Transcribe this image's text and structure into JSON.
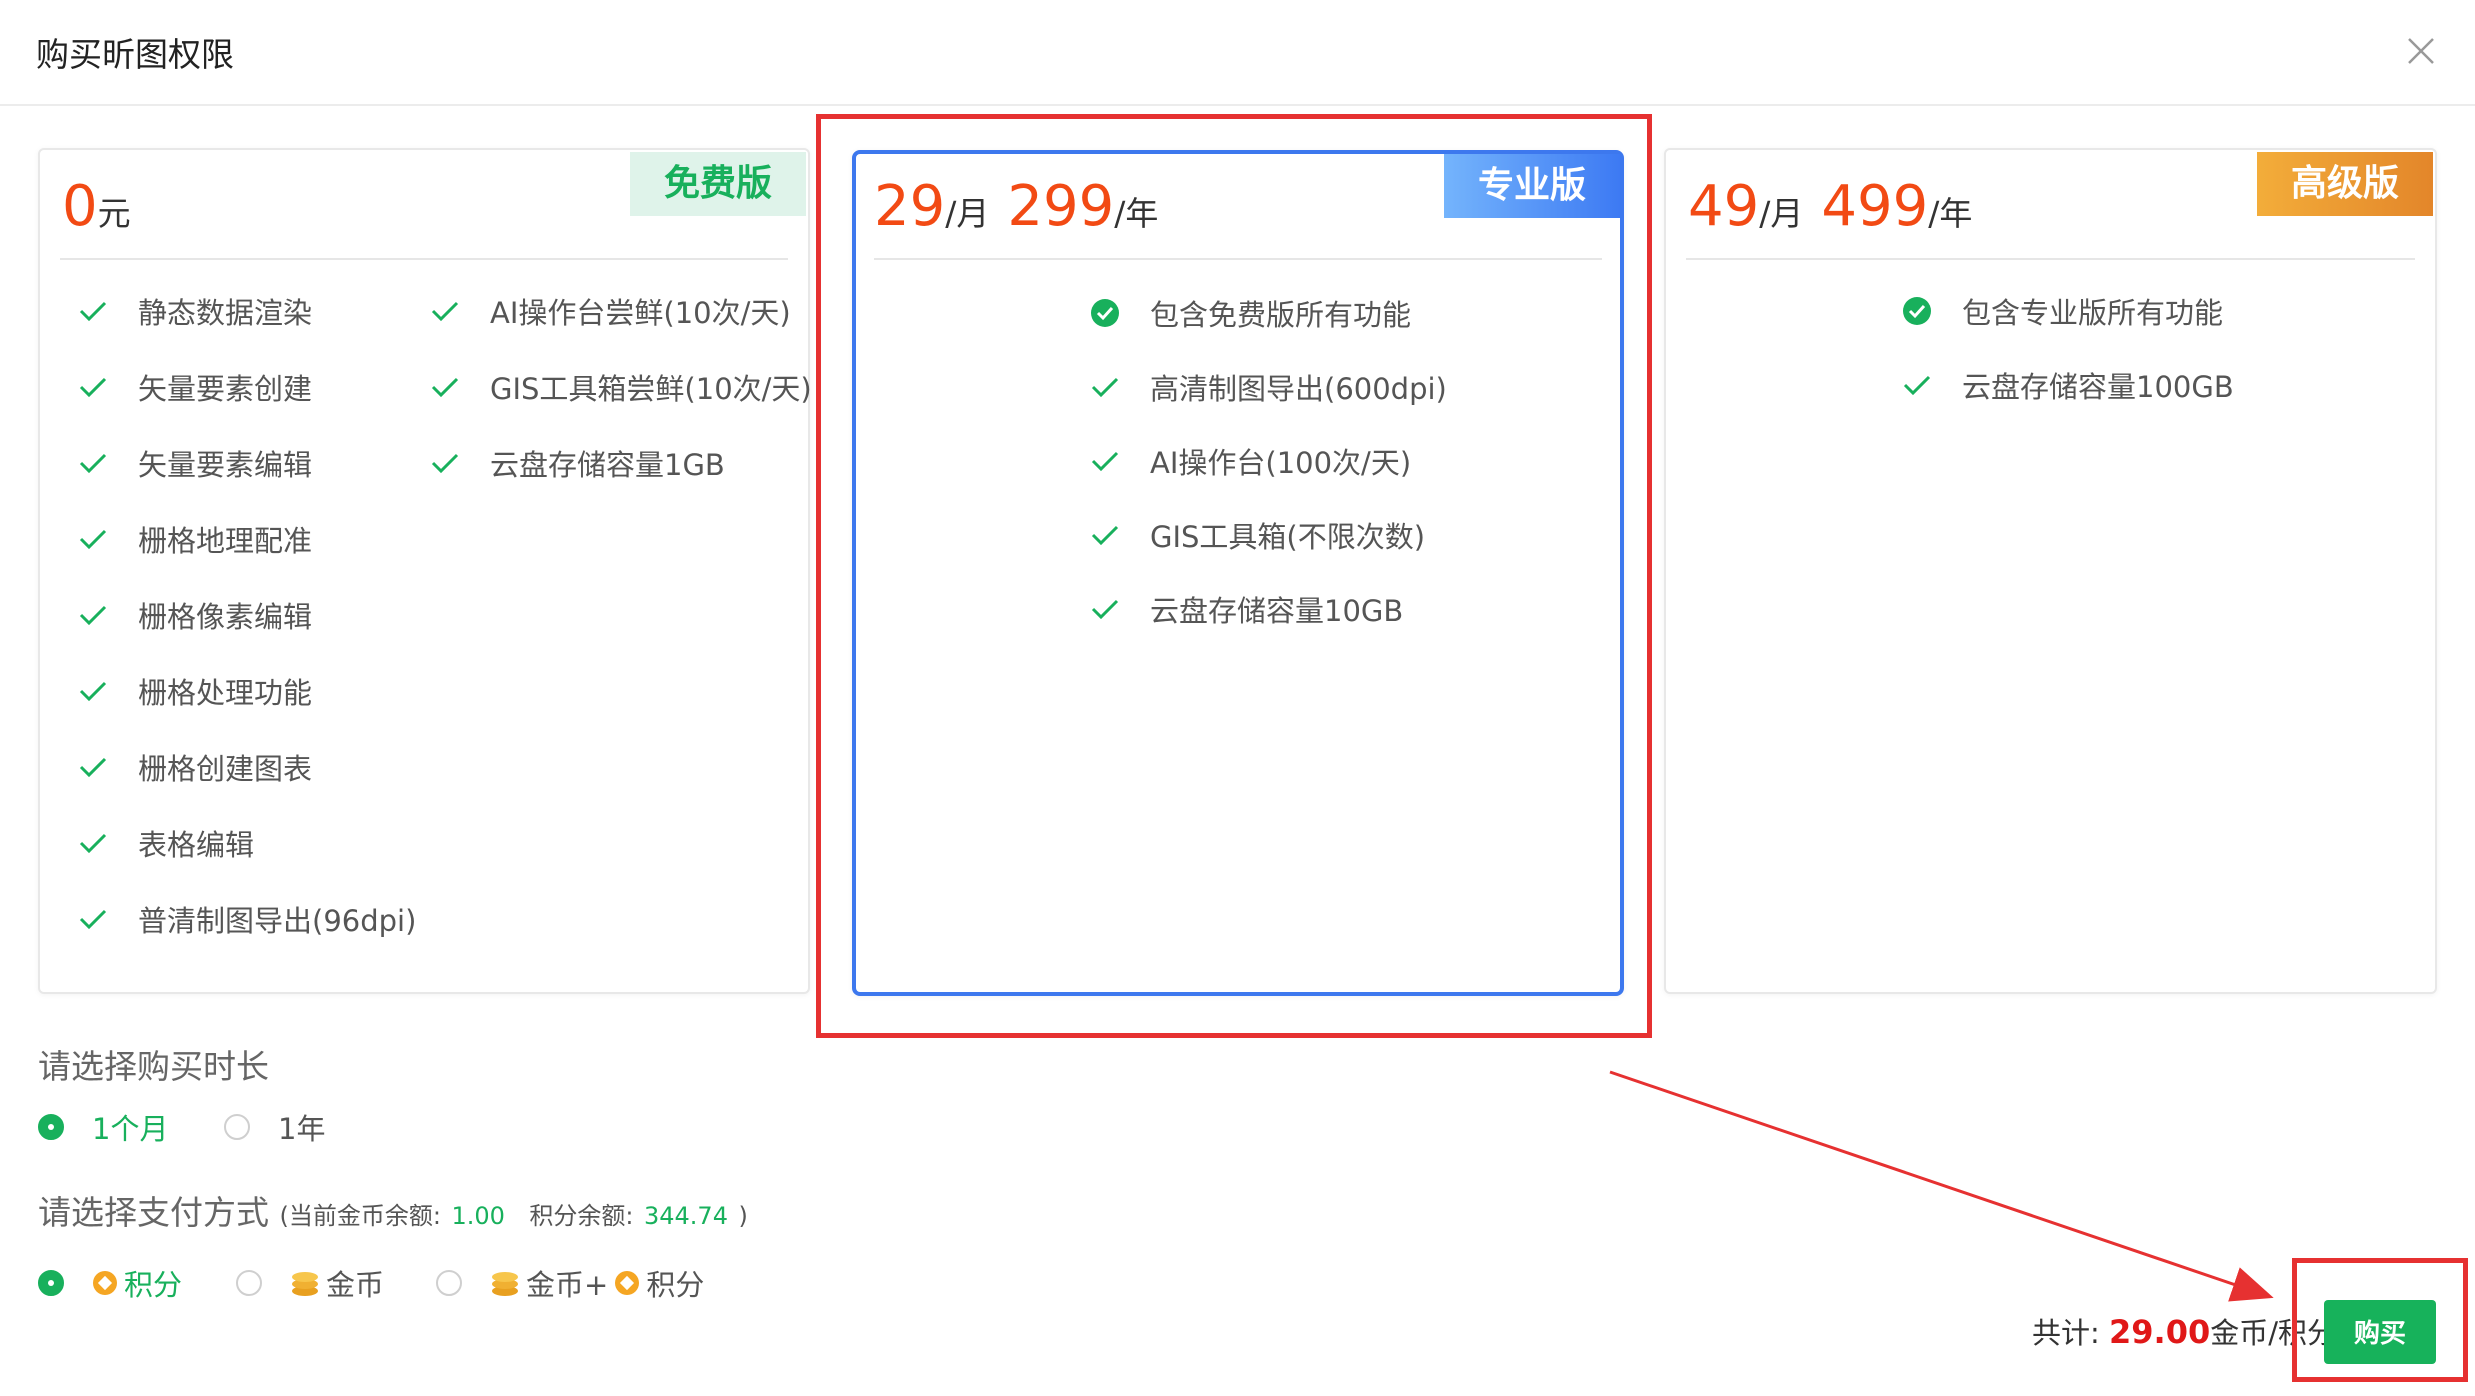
{
  "dialog": {
    "title": "购买昕图权限"
  },
  "plans": {
    "free": {
      "badge": "免费版",
      "price_num": "0",
      "price_unit": "元",
      "features_left": [
        "静态数据渲染",
        "矢量要素创建",
        "矢量要素编辑",
        "栅格地理配准",
        "栅格像素编辑",
        "栅格处理功能",
        "栅格创建图表",
        "表格编辑",
        "普清制图导出(96dpi)"
      ],
      "features_right": [
        "AI操作台尝鲜(10次/天)",
        "GIS工具箱尝鲜(10次/天)",
        "云盘存储容量1GB"
      ]
    },
    "pro": {
      "badge": "专业版",
      "month_num": "29",
      "month_unit": "/月",
      "year_num": "299",
      "year_unit": "/年",
      "features": [
        "包含免费版所有功能",
        "高清制图导出(600dpi)",
        "AI操作台(100次/天)",
        "GIS工具箱(不限次数)",
        "云盘存储容量10GB"
      ]
    },
    "advanced": {
      "badge": "高级版",
      "month_num": "49",
      "month_unit": "/月",
      "year_num": "499",
      "year_unit": "/年",
      "features": [
        "包含专业版所有功能",
        "云盘存储容量100GB"
      ]
    }
  },
  "duration": {
    "label": "请选择购买时长",
    "options": [
      "1个月",
      "1年"
    ],
    "selected": "1个月"
  },
  "payment": {
    "label": "请选择支付方式",
    "balance_prefix": "(当前金币余额:",
    "coin_balance": "1.00",
    "points_prefix": "积分余额:",
    "points_balance": "344.74",
    "balance_suffix": ")",
    "options": [
      "积分",
      "金币",
      "金币+",
      "积分"
    ],
    "selected": "积分"
  },
  "footer": {
    "total_label": "共计:",
    "total_amount": "29.00",
    "total_unit": "金币/积分",
    "buy_label": "购买"
  },
  "colors": {
    "accent_green": "#17b25b",
    "price_orange": "#f24a14",
    "pro_blue": "#3d78ee",
    "highlight_red": "#e63131"
  },
  "icons": {
    "check": "check-icon",
    "check_circle": "check-circle-icon",
    "close": "close-icon",
    "points": "points-coin-icon",
    "gold": "gold-coin-stack-icon"
  }
}
